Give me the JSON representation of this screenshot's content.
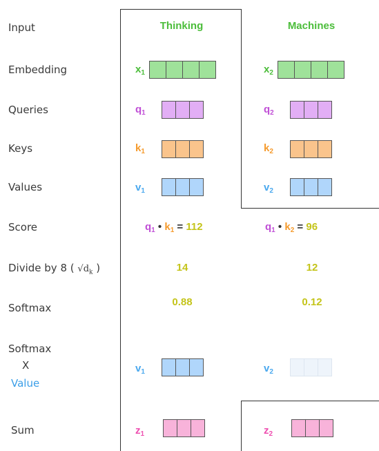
{
  "rows": {
    "input": "Input",
    "embedding": "Embedding",
    "queries": "Queries",
    "keys": "Keys",
    "values": "Values",
    "score": "Score",
    "divide_prefix": "Divide by 8 (",
    "divide_sqrt": "√d",
    "divide_sub": "k",
    "divide_suffix": ")",
    "softmax": "Softmax",
    "softmax_x_value_1": "Softmax",
    "softmax_x_value_2": "X",
    "softmax_x_value_3": "Value",
    "sum": "Sum"
  },
  "words": [
    "Thinking",
    "Machines"
  ],
  "symbols": {
    "x1": "x",
    "x1_sub": "1",
    "x2": "x",
    "x2_sub": "2",
    "q1": "q",
    "q1_sub": "1",
    "q2": "q",
    "q2_sub": "2",
    "k1": "k",
    "k1_sub": "1",
    "k2": "k",
    "k2_sub": "2",
    "v1": "v",
    "v1_sub": "1",
    "v2": "v",
    "v2_sub": "2",
    "z1": "z",
    "z1_sub": "1",
    "z2": "z",
    "z2_sub": "2"
  },
  "score": {
    "s1_q": "q",
    "s1_q_sub": "1",
    "s1_dot": "•",
    "s1_k": "k",
    "s1_k_sub": "1",
    "s1_eq": "=",
    "s1_val": "112",
    "s2_q": "q",
    "s2_q_sub": "1",
    "s2_dot": "•",
    "s2_k": "k",
    "s2_k_sub": "2",
    "s2_eq": "=",
    "s2_val": "96"
  },
  "divided": [
    "14",
    "12"
  ],
  "softmax": [
    "0.88",
    "0.12"
  ],
  "colors": {
    "embedding": "#9fe29a",
    "query": "#e2aef5",
    "key": "#fac48c",
    "value": "#b0d6fb",
    "value_faded": "#eef4fb",
    "sum": "#f8b3da",
    "green": "#4bbd3a",
    "purple": "#c04fd6",
    "orange": "#f59a2c",
    "blue": "#4aa8ee",
    "pink": "#ee4fb0",
    "yellow": "#c4c41a"
  }
}
